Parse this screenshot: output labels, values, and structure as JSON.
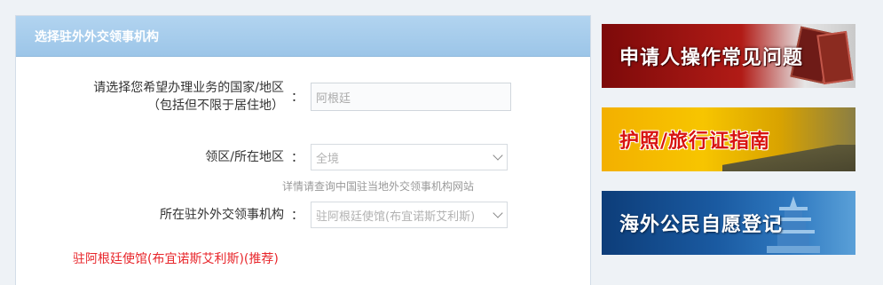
{
  "panel": {
    "title": "选择驻外外交领事机构"
  },
  "country": {
    "label_line1": "请选择您希望办理业务的国家/地区",
    "label_line2": "（包括但不限于居住地）",
    "colon": "：",
    "value": "阿根廷"
  },
  "region": {
    "label": "领区/所在地区",
    "colon": "：",
    "value": "全境"
  },
  "hint": "详情请查询中国驻当地外交领事机构网站",
  "mission": {
    "label": "所在驻外外交领事机构",
    "colon": "：",
    "value": "驻阿根廷使馆(布宜诺斯艾利斯)"
  },
  "result": "驻阿根廷使馆(布宜诺斯艾利斯)(推荐)",
  "banners": [
    {
      "text": "申请人操作常见问题"
    },
    {
      "text": "护照/旅行证指南"
    },
    {
      "text": "海外公民自愿登记"
    }
  ],
  "colors": {
    "header": "#9cc5e8",
    "recommend": "#e8262b"
  }
}
